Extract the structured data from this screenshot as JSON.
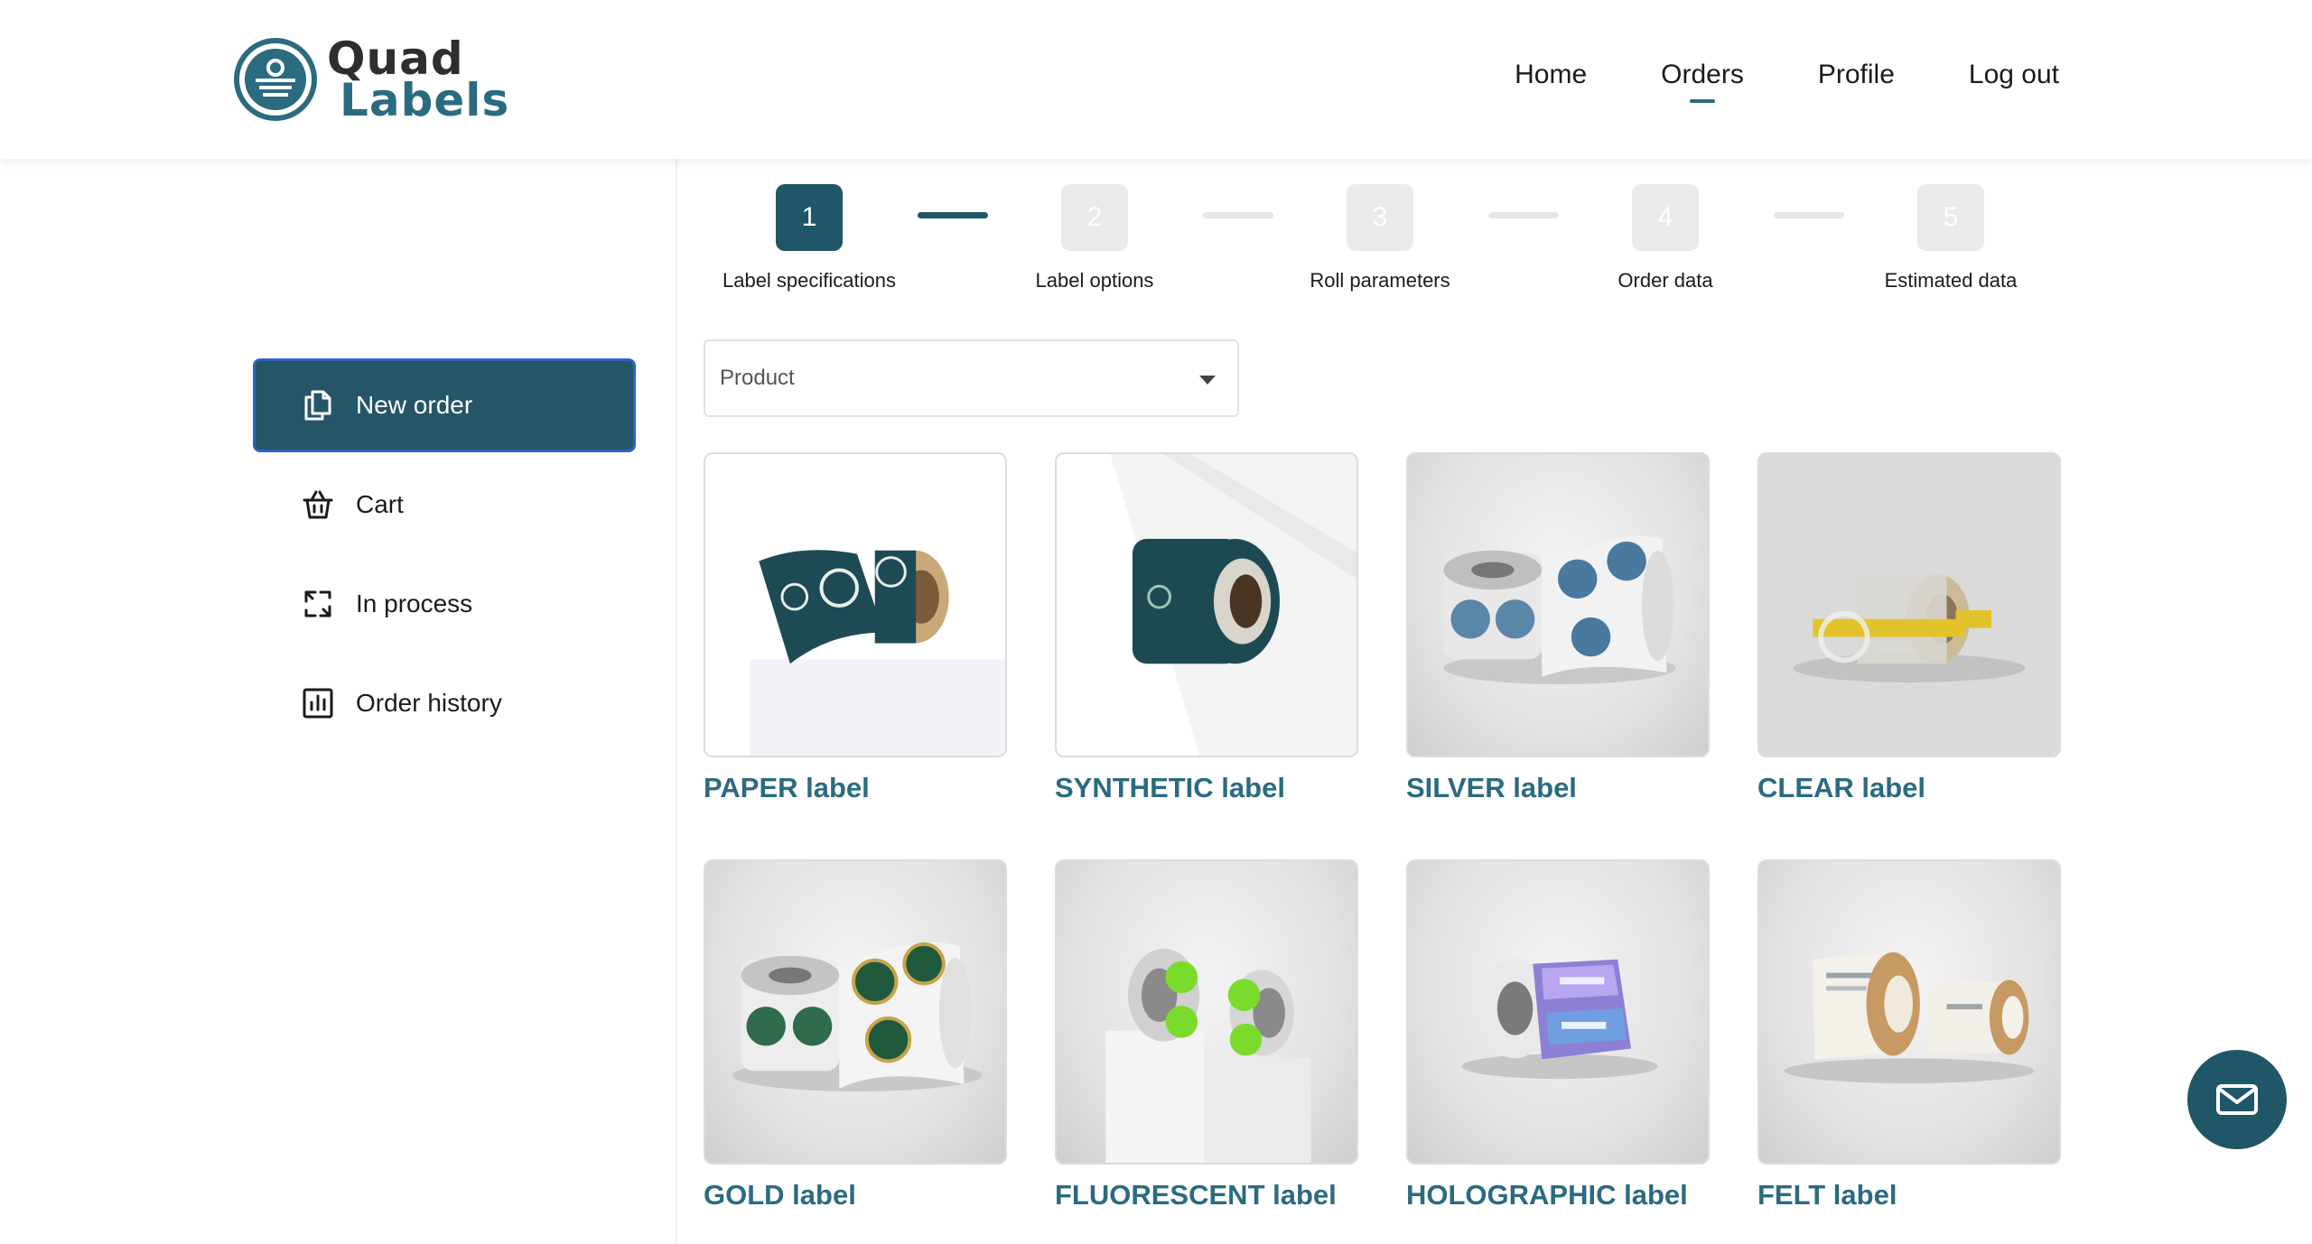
{
  "brand": {
    "line1": "Quad",
    "line2": "Labels"
  },
  "nav": {
    "home": "Home",
    "orders": "Orders",
    "profile": "Profile",
    "logout": "Log out",
    "active": "Orders"
  },
  "sidebar": {
    "items": [
      {
        "label": "New order",
        "icon": "new-order-icon",
        "active": true
      },
      {
        "label": "Cart",
        "icon": "basket-icon",
        "active": false
      },
      {
        "label": "In process",
        "icon": "process-arrows-icon",
        "active": false
      },
      {
        "label": "Order history",
        "icon": "bar-chart-icon",
        "active": false
      }
    ]
  },
  "stepper": {
    "steps": [
      {
        "number": "1",
        "label": "Label specifications",
        "state": "active"
      },
      {
        "number": "2",
        "label": "Label options",
        "state": "pending"
      },
      {
        "number": "3",
        "label": "Roll parameters",
        "state": "pending"
      },
      {
        "number": "4",
        "label": "Order data",
        "state": "pending"
      },
      {
        "number": "5",
        "label": "Estimated data",
        "state": "pending"
      }
    ]
  },
  "product_select": {
    "placeholder": "Product"
  },
  "products": [
    {
      "name": "PAPER label"
    },
    {
      "name": "SYNTHETIC label"
    },
    {
      "name": "SILVER label"
    },
    {
      "name": "CLEAR label"
    },
    {
      "name": "GOLD label"
    },
    {
      "name": "FLUORESCENT label"
    },
    {
      "name": "HOLOGRAPHIC label"
    },
    {
      "name": "FELT label"
    }
  ],
  "colors": {
    "primary": "#1f5668",
    "accent_text": "#2a6b80",
    "active_border": "#2e63c2",
    "step_inactive": "#eaeaea"
  },
  "fab": {
    "icon": "mail-icon"
  }
}
